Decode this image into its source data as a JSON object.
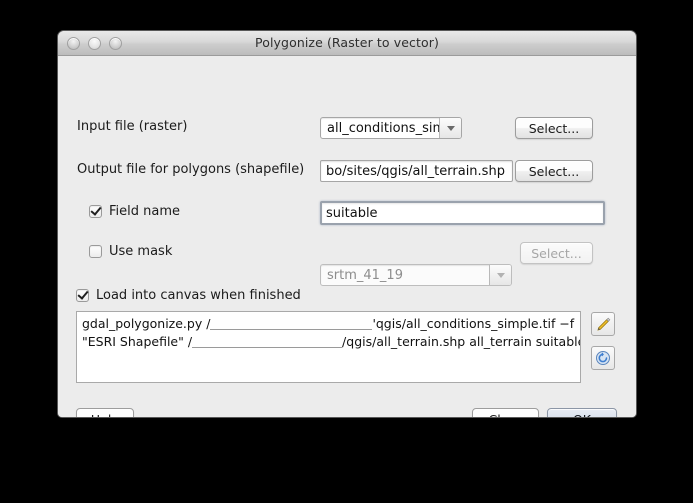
{
  "window": {
    "title": "Polygonize (Raster to vector)",
    "traffic_lights": [
      "close-button",
      "minimize-button",
      "zoom-button"
    ]
  },
  "form": {
    "input_file": {
      "label": "Input file (raster)",
      "value": "all_conditions_simple",
      "select_label": "Select..."
    },
    "output_file": {
      "label": "Output file for polygons (shapefile)",
      "value": "bo/sites/qgis/all_terrain.shp",
      "select_label": "Select..."
    },
    "field_name": {
      "label": "Field name",
      "checked": true,
      "value": "suitable"
    },
    "use_mask": {
      "label": "Use mask",
      "checked": false,
      "value": "srtm_41_19",
      "select_label": "Select..."
    },
    "load_into_canvas": {
      "label": "Load into canvas when finished",
      "checked": true
    }
  },
  "command": {
    "line1_prefix": "gdal_polygonize.py /",
    "line1_suffix": "'qgis/all_conditions_simple.tif −f",
    "line2_prefix": "\"ESRI Shapefile\" /",
    "line2_suffix": "/qgis/all_terrain.shp all_terrain suitable"
  },
  "side_buttons": {
    "edit": "pencil-icon",
    "refresh": "refresh-icon"
  },
  "footer": {
    "help_label": "Help",
    "close_label": "Close",
    "ok_label": "OK"
  },
  "colors": {
    "dialog_bg": "#ececec",
    "desktop_bg": "#000000",
    "default_button": "#cbd5e4",
    "pencil_yellow": "#f2c12b",
    "refresh_blue": "#3f7fd0"
  }
}
